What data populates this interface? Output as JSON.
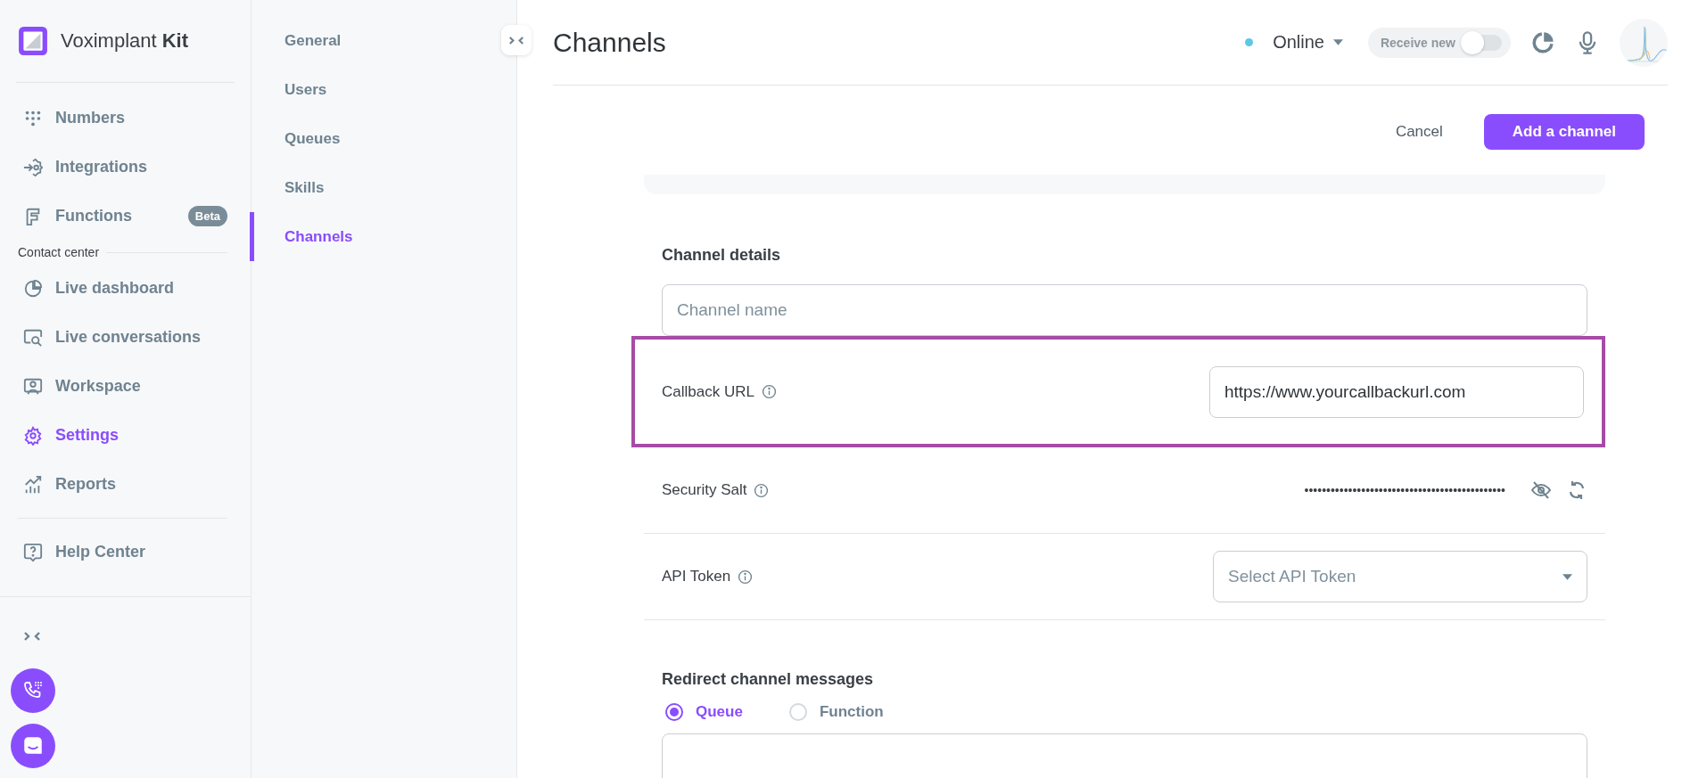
{
  "brand": {
    "name": "Voximplant",
    "suffix": "Kit"
  },
  "nav": [
    {
      "label": "Numbers",
      "selected": false
    },
    {
      "label": "Integrations",
      "selected": false
    },
    {
      "label": "Functions",
      "selected": false,
      "badge": "Beta"
    }
  ],
  "nav_section": "Contact center",
  "nav_cc": [
    {
      "label": "Live dashboard",
      "selected": false
    },
    {
      "label": "Live conversations",
      "selected": false
    },
    {
      "label": "Workspace",
      "selected": false
    },
    {
      "label": "Settings",
      "selected": true
    },
    {
      "label": "Reports",
      "selected": false
    }
  ],
  "help": {
    "label": "Help Center"
  },
  "settings_menu": [
    {
      "label": "General",
      "selected": false
    },
    {
      "label": "Users",
      "selected": false
    },
    {
      "label": "Queues",
      "selected": false
    },
    {
      "label": "Skills",
      "selected": false
    },
    {
      "label": "Channels",
      "selected": true
    }
  ],
  "page_title": "Channels",
  "status": {
    "label": "Online",
    "color": "#5bc8e8"
  },
  "receive_new": {
    "label": "Receive new",
    "on": false
  },
  "actions": {
    "cancel": "Cancel",
    "submit": "Add a channel"
  },
  "details": {
    "heading": "Channel details",
    "name_field": {
      "placeholder": "Channel name"
    },
    "rows": [
      {
        "kind": "url",
        "label": "Callback URL",
        "value": "https://www.yourcallbackurl.com",
        "highlighted": true
      },
      {
        "kind": "secret",
        "label": "Security Salt",
        "value": "••••••••••••••••••••••••••••••••••••••••••••••"
      },
      {
        "kind": "select",
        "label": "API Token",
        "placeholder": "Select API Token"
      }
    ]
  },
  "redirect": {
    "heading": "Redirect channel messages",
    "options": [
      {
        "label": "Queue",
        "selected": true
      },
      {
        "label": "Function",
        "selected": false
      }
    ]
  }
}
